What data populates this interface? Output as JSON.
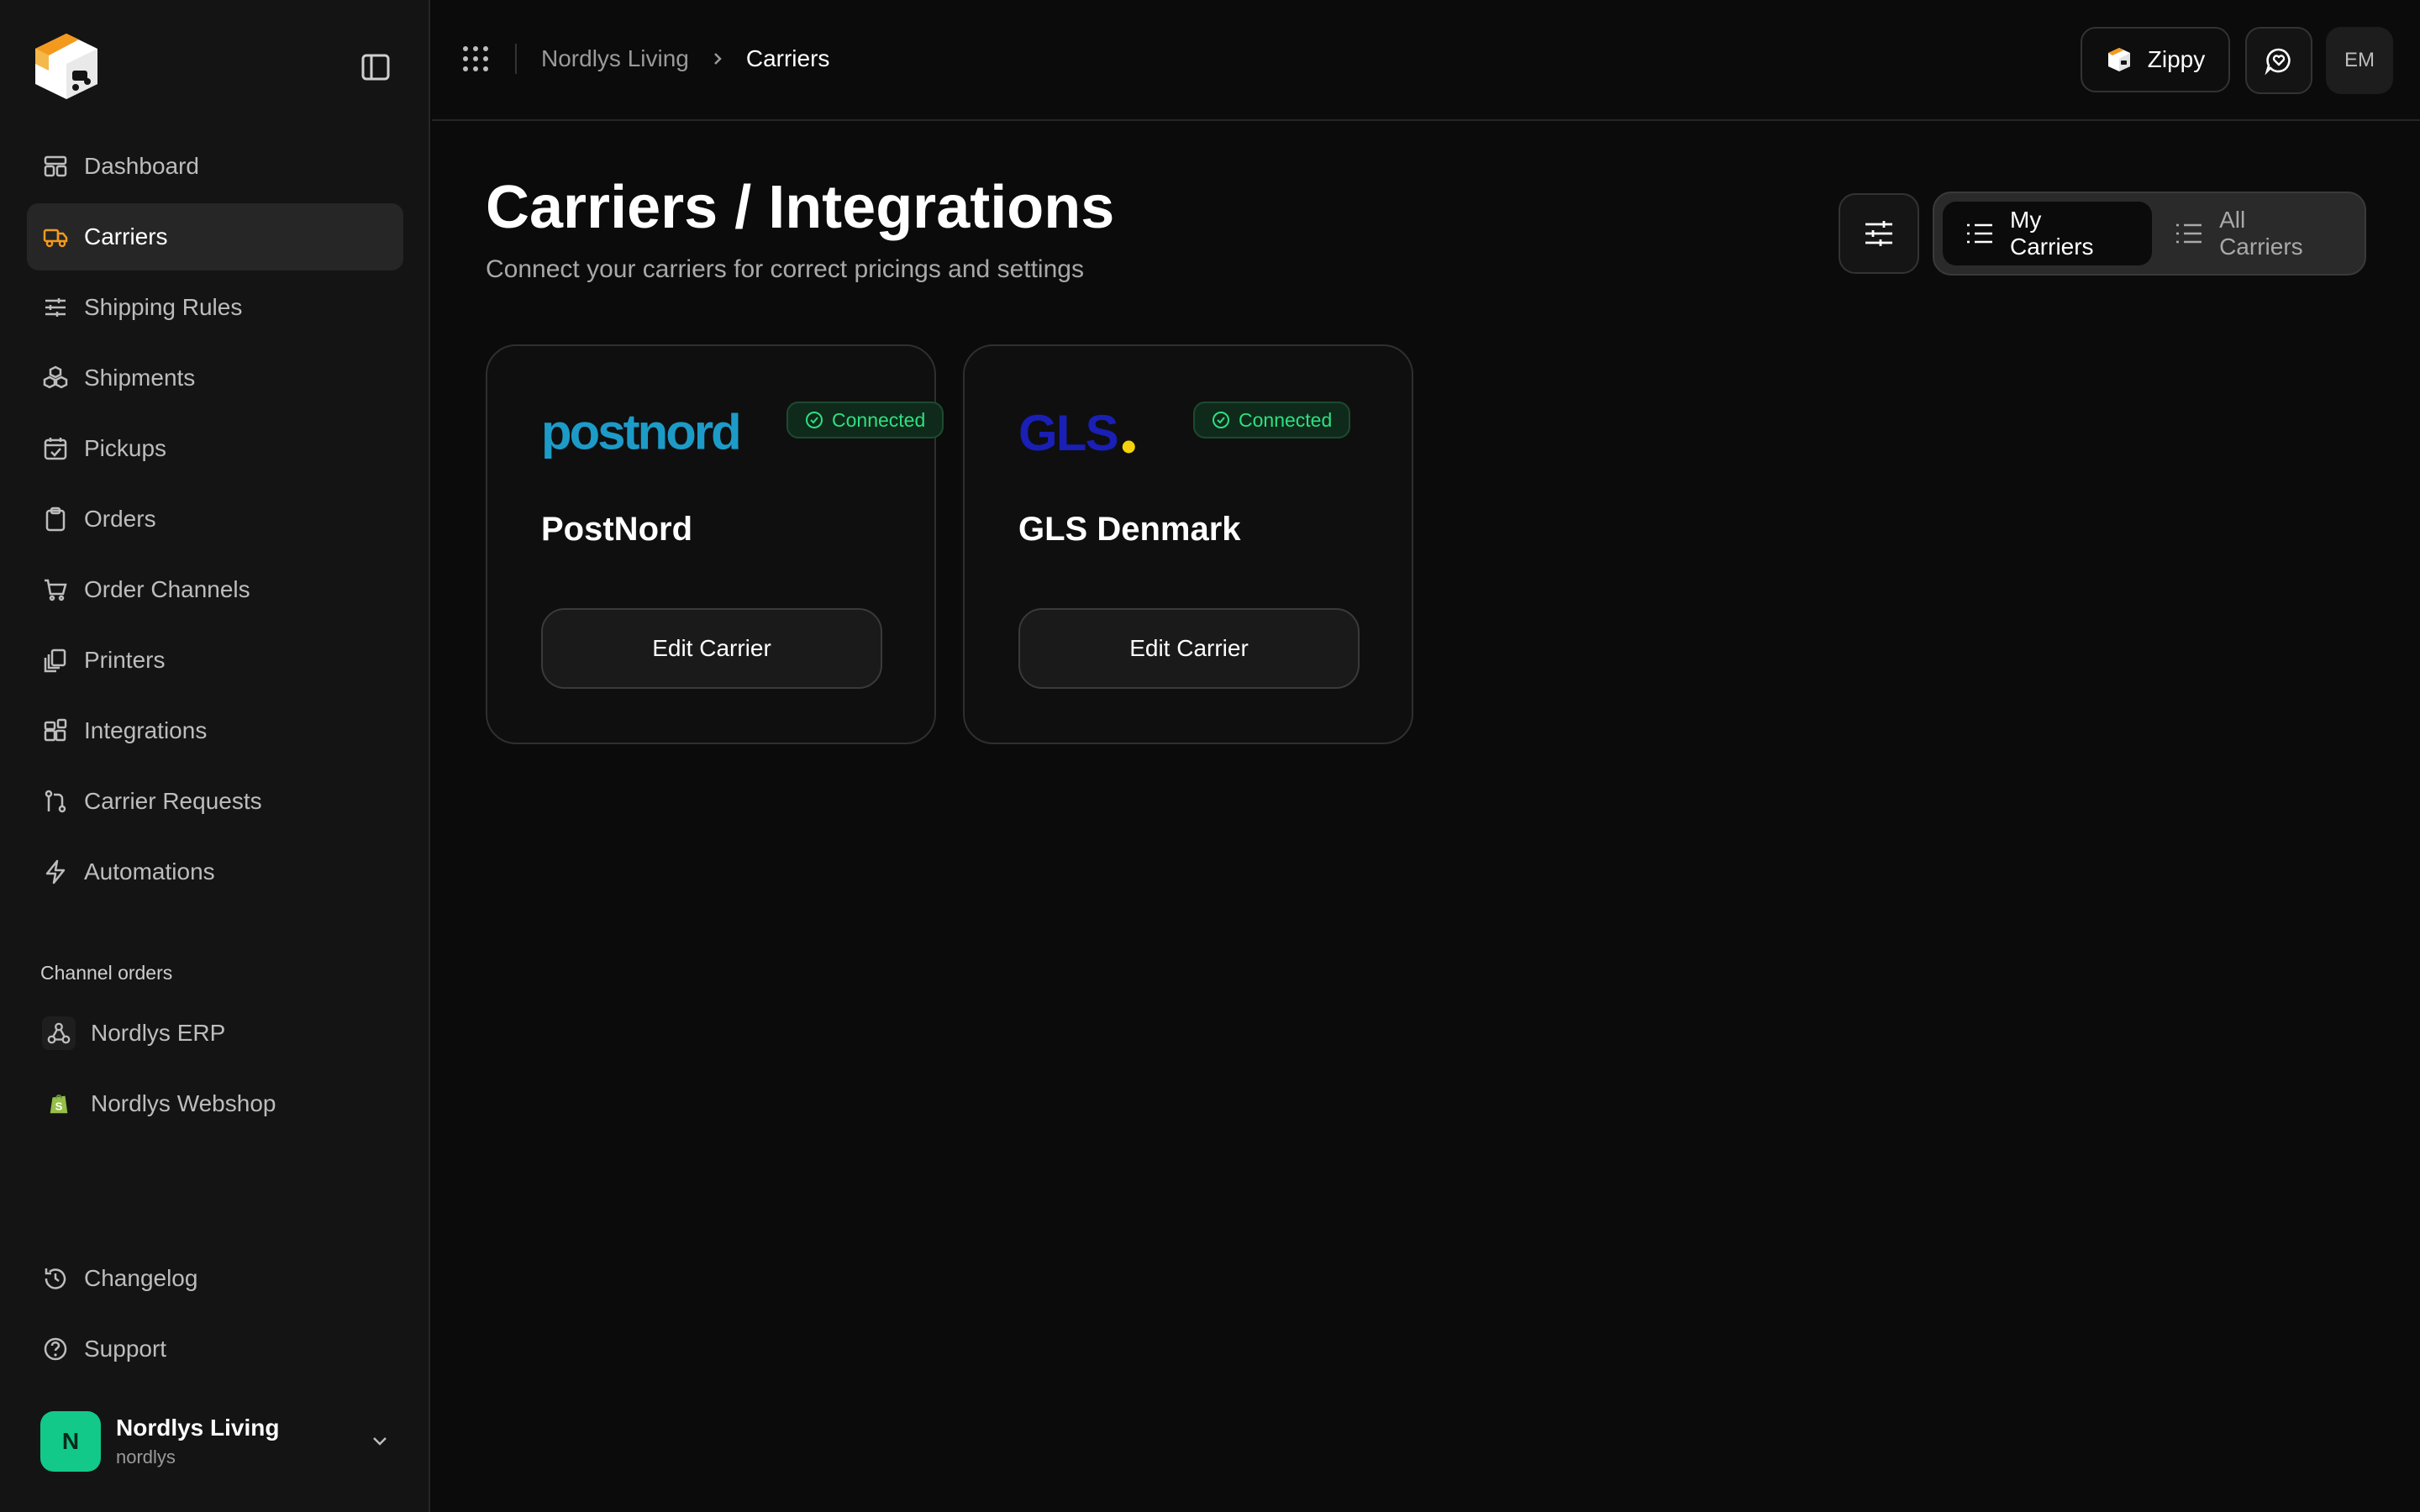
{
  "sidebar": {
    "items": [
      {
        "label": "Dashboard",
        "icon": "dashboard-icon"
      },
      {
        "label": "Carriers",
        "icon": "truck-icon",
        "active": true
      },
      {
        "label": "Shipping Rules",
        "icon": "sliders-icon"
      },
      {
        "label": "Shipments",
        "icon": "boxes-icon"
      },
      {
        "label": "Pickups",
        "icon": "calendar-check-icon"
      },
      {
        "label": "Orders",
        "icon": "clipboard-icon"
      },
      {
        "label": "Order Channels",
        "icon": "cart-icon"
      },
      {
        "label": "Printers",
        "icon": "copies-icon"
      },
      {
        "label": "Integrations",
        "icon": "blocks-icon"
      },
      {
        "label": "Carrier Requests",
        "icon": "git-pull-request-icon"
      },
      {
        "label": "Automations",
        "icon": "zap-icon"
      }
    ],
    "channel_section_label": "Channel orders",
    "channels": [
      {
        "label": "Nordlys ERP",
        "icon": "webhook-icon"
      },
      {
        "label": "Nordlys Webshop",
        "icon": "shopify-icon"
      }
    ],
    "bottom_items": [
      {
        "label": "Changelog",
        "icon": "history-icon"
      },
      {
        "label": "Support",
        "icon": "help-circle-icon"
      }
    ],
    "account": {
      "initial": "N",
      "name": "Nordlys Living",
      "handle": "nordlys"
    }
  },
  "topbar": {
    "breadcrumb_parent": "Nordlys Living",
    "breadcrumb_current": "Carriers",
    "zippy_label": "Zippy",
    "user_initials": "EM"
  },
  "main": {
    "title": "Carriers / Integrations",
    "subtitle": "Connect your carriers for correct pricings and settings",
    "tabs": [
      {
        "label": "My Carriers",
        "active": true
      },
      {
        "label": "All Carriers",
        "active": false
      }
    ],
    "carriers": [
      {
        "name": "PostNord",
        "logo_text": "postnord",
        "status": "Connected",
        "button": "Edit Carrier"
      },
      {
        "name": "GLS Denmark",
        "logo_text": "GLS",
        "status": "Connected",
        "button": "Edit Carrier"
      }
    ]
  },
  "colors": {
    "accent_orange": "#f39a1e",
    "connected_green": "#2ee07f",
    "avatar_green": "#12c98a",
    "postnord_blue": "#1d9bc8",
    "gls_blue": "#1a1fb5",
    "gls_yellow": "#f5d20b"
  }
}
